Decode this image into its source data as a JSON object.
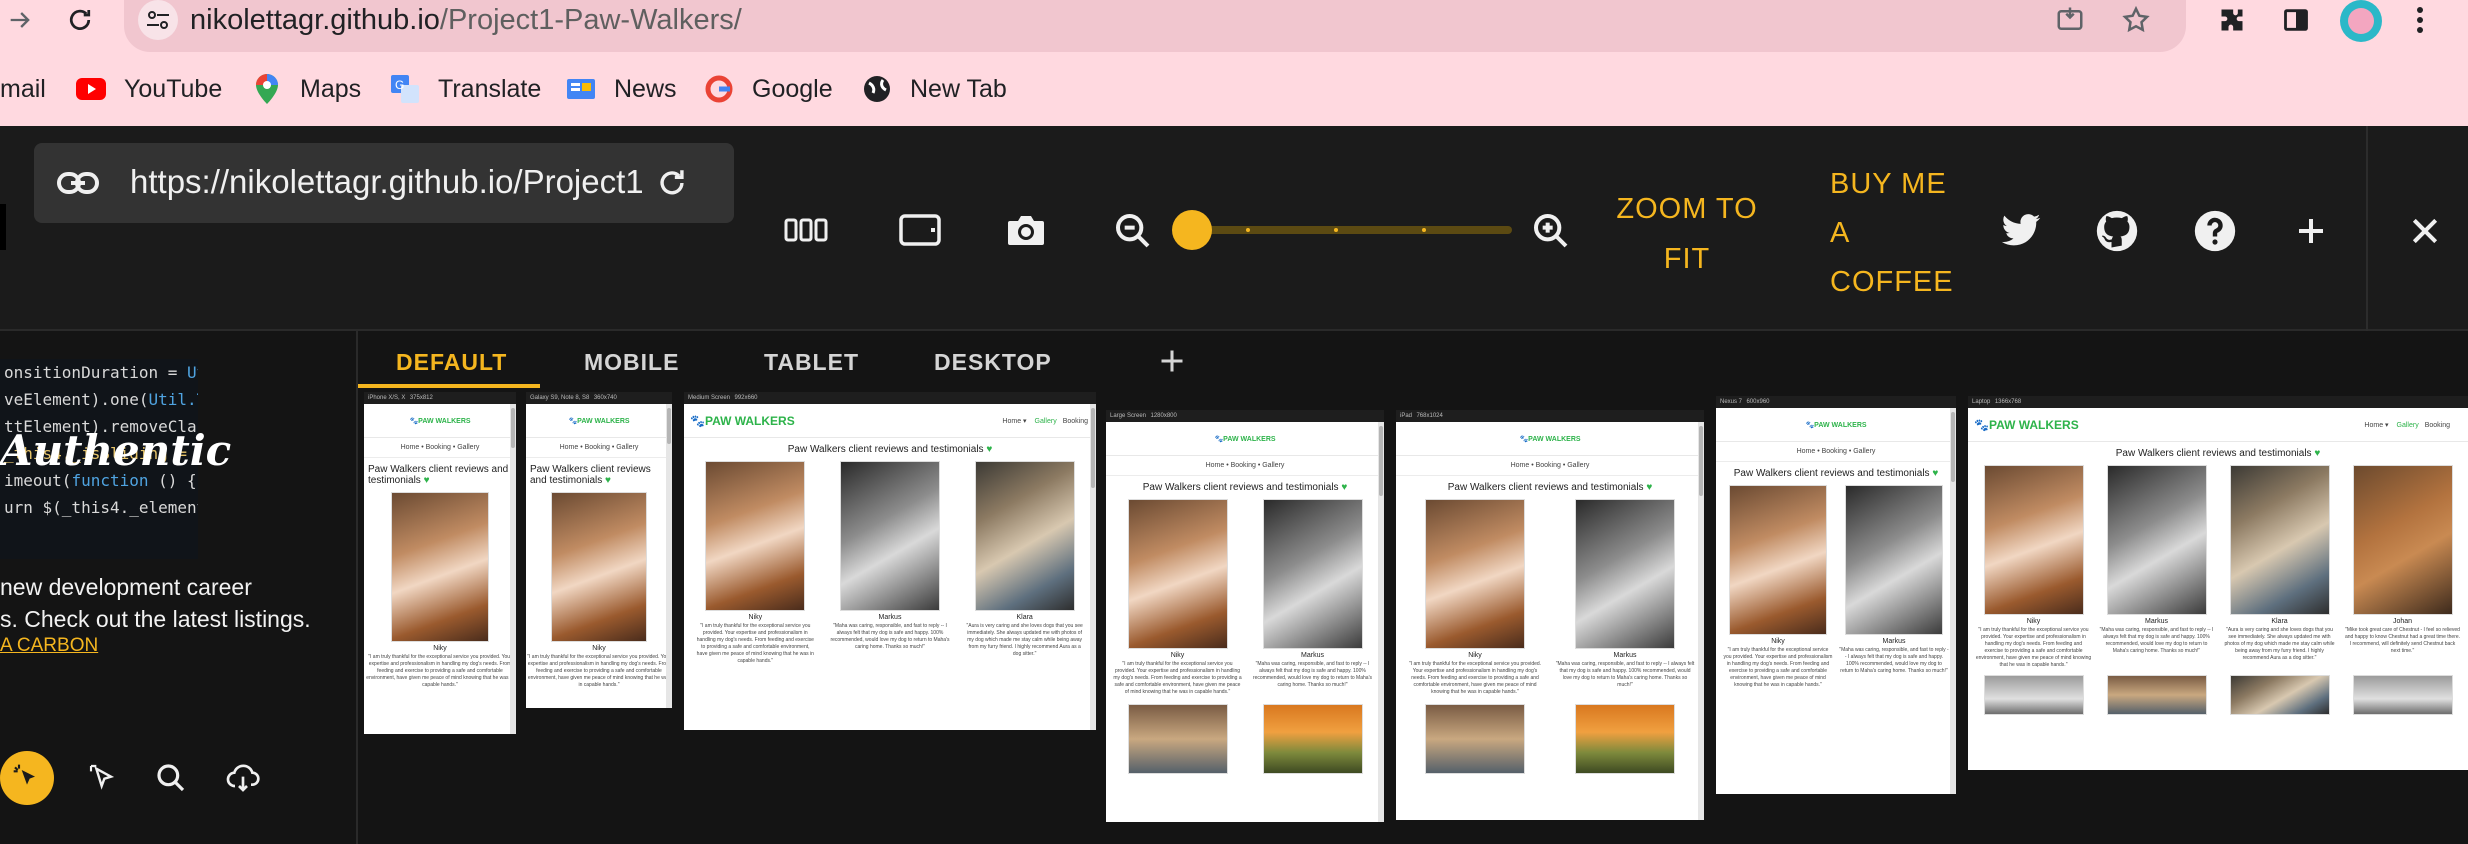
{
  "browser": {
    "url_host": "nikolettagr.github.io",
    "url_path": "/Project1-Paw-Walkers/",
    "bookmarks": [
      {
        "label": "mail",
        "icon": "gmail-icon"
      },
      {
        "label": "YouTube",
        "icon": "youtube-icon"
      },
      {
        "label": "Maps",
        "icon": "maps-icon"
      },
      {
        "label": "Translate",
        "icon": "translate-icon"
      },
      {
        "label": "News",
        "icon": "news-icon"
      },
      {
        "label": "Google",
        "icon": "google-icon"
      },
      {
        "label": "New Tab",
        "icon": "globe-icon"
      }
    ]
  },
  "toolbar": {
    "url": "https://nikolettagr.github.io/Project1",
    "zoom_to_fit_line1": "ZOOM TO",
    "zoom_to_fit_line2": "FIT",
    "coffee_line1": "BUY ME",
    "coffee_line2": "A",
    "coffee_line3": "COFFEE",
    "zoom_level": 0
  },
  "ad": {
    "image_word": "Authentic",
    "text_line1": "new development career",
    "text_line2": "s. Check out the latest listings.",
    "link": "A CARBON"
  },
  "tabs": [
    {
      "label": "DEFAULT",
      "active": true
    },
    {
      "label": "MOBILE",
      "active": false
    },
    {
      "label": "TABLET",
      "active": false
    },
    {
      "label": "DESKTOP",
      "active": false
    }
  ],
  "site": {
    "logo": "PAW WALKERS",
    "nav": [
      "Home",
      "Gallery",
      "Booking"
    ],
    "crumbs": "Home  •  Booking  •  Gallery",
    "heading": "Paw Walkers client reviews and testimonials",
    "reviewers": [
      {
        "name": "Niky",
        "quote": "\"I am truly thankful for the exceptional service you provided. Your expertise and professionalism in handling my dog's needs. From feeding and exercise to providing a safe and comfortable environment, have given me peace of mind knowing that he was in capable hands.\""
      },
      {
        "name": "Markus",
        "quote": "\"Maha was caring, responsible, and fast to reply -- I always felt that my dog is safe and happy. 100% recommended, would love my dog to return to Maha's caring home. Thanks so much!\""
      },
      {
        "name": "Klara",
        "quote": "\"Aura is very caring and she loves dogs that you see immediately. She always updated me with photos of my dog which made me stay calm while being away from my furry friend. I highly recommend Aura as a dog sitter.\""
      },
      {
        "name": "Johan",
        "quote": "\"Mike took great care of Chestnut - I feel so relieved and happy to know Chestnut had a great time there. I recommend, will definitely send Chestnut back next time.\""
      }
    ]
  },
  "devices": [
    {
      "label": "iPhone X/S, X",
      "size": "375x812"
    },
    {
      "label": "Galaxy S9, Note 8, S8",
      "size": "360x740"
    },
    {
      "label": "Medium Screen",
      "size": "992x660"
    },
    {
      "label": "Large Screen",
      "size": "1280x800"
    },
    {
      "label": "iPad",
      "size": "768x1024"
    },
    {
      "label": "Nexus 7",
      "size": "600x960"
    },
    {
      "label": "Laptop",
      "size": "1366x768"
    }
  ]
}
